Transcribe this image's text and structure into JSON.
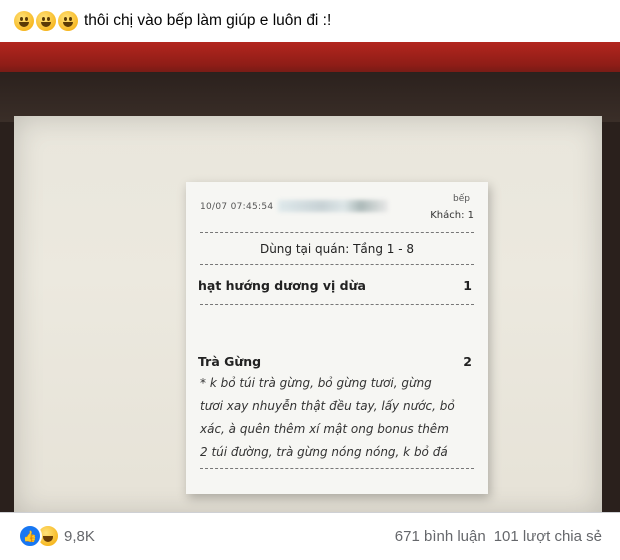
{
  "post": {
    "caption": "thôi chị vào bếp làm giúp e luôn đi :!"
  },
  "receipt": {
    "datetime": "10/07 07:45:54",
    "station": "bếp",
    "guest": "Khách: 1",
    "dine_in": "Dùng tại quán: Tầng 1 - 8",
    "items": [
      {
        "name": "hạt hướng dương vị dừa",
        "qty": "1"
      },
      {
        "name": "Trà Gừng",
        "qty": "2"
      }
    ],
    "note": "* k bỏ túi trà gừng, bỏ gừng tươi, gừng\ntươi xay nhuyễn thật đều tay, lấy nước, bỏ\nxác, à quên thêm xí mật ong bonus thêm\n2 túi đường, trà gừng nóng nóng, k bỏ đá"
  },
  "footer": {
    "reaction_count": "9,8K",
    "comments": "671 bình luận",
    "shares": "101 lượt chia sẻ"
  },
  "colors": {
    "like_blue": "#1877f2",
    "meta_gray": "#65676b"
  },
  "icons": [
    "grinning-emoji-icon",
    "like-reaction-icon",
    "haha-reaction-icon"
  ]
}
